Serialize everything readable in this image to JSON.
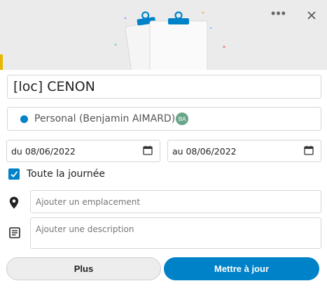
{
  "header": {
    "more_icon": "more-horizontal-icon",
    "more_glyph": "•••",
    "close_icon": "close-icon",
    "illustration": "clipboard-illustration"
  },
  "event": {
    "title": "[loc] CENON",
    "calendar": {
      "label": "Personal (Benjamin AIMARD)",
      "avatar_initials": "BA",
      "color": "#0082c9"
    },
    "start_date": "du 08/06/2022",
    "end_date": "au 08/06/2022",
    "all_day": {
      "label": "Toute la journée",
      "checked": true
    },
    "location": {
      "icon": "map-marker-icon",
      "placeholder": "Ajouter un emplacement",
      "value": ""
    },
    "description": {
      "icon": "text-lines-icon",
      "placeholder": "Ajouter une description",
      "value": ""
    }
  },
  "actions": {
    "more_label": "Plus",
    "update_label": "Mettre à jour",
    "primary_color": "#0082c9"
  }
}
